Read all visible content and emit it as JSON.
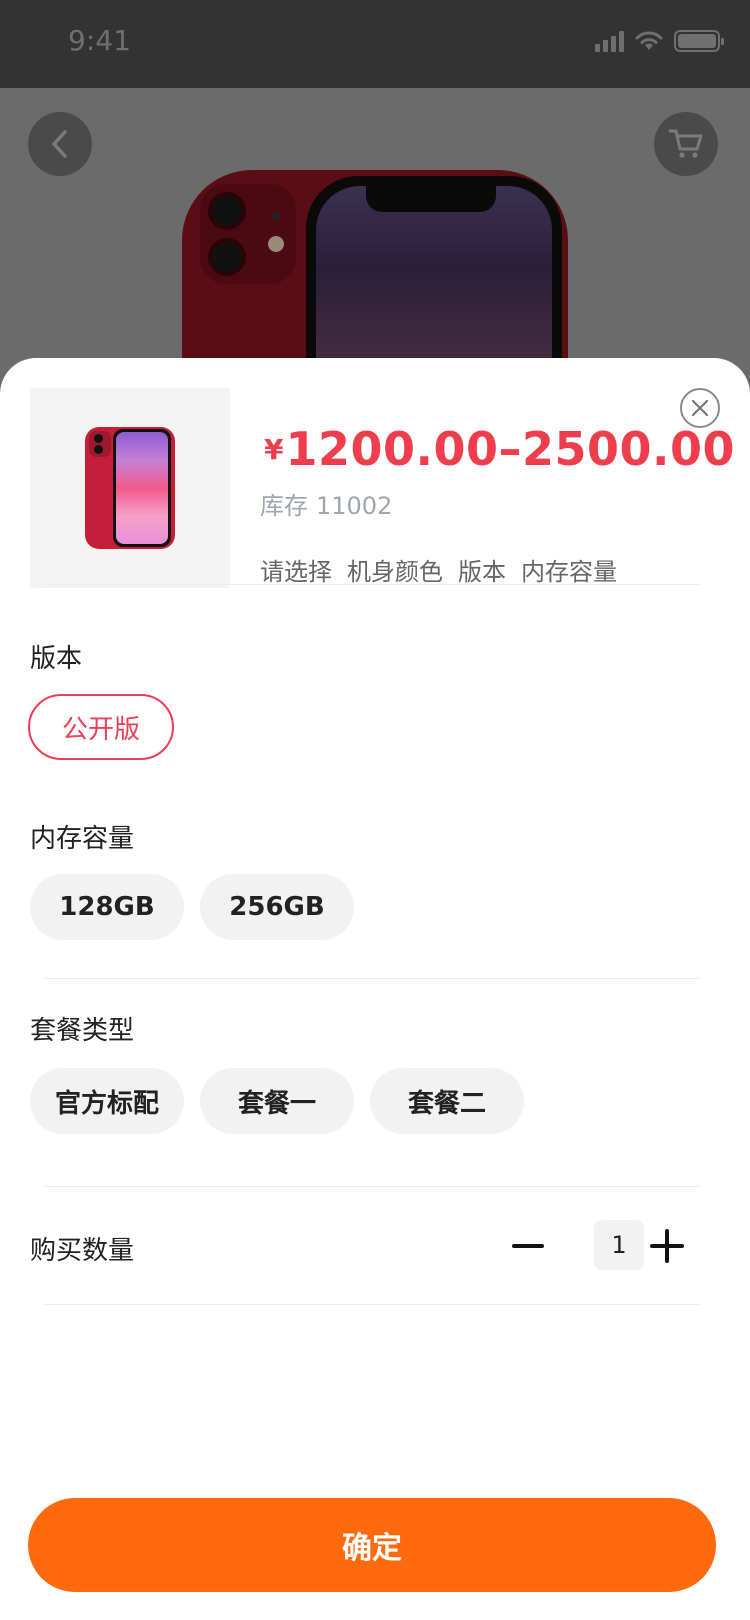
{
  "status_bar": {
    "time": "9:41"
  },
  "product": {
    "currency": "¥",
    "price_range": "1200.00–2500.00",
    "stock_label": "库存",
    "stock_count": "11002",
    "choose_prompt": [
      "请选择",
      "机身颜色",
      "版本",
      "内存容量"
    ]
  },
  "sections": {
    "version": {
      "label": "版本",
      "options": [
        "公开版"
      ],
      "selected": "公开版"
    },
    "storage": {
      "label": "内存容量",
      "options": [
        "128GB",
        "256GB"
      ]
    },
    "package": {
      "label": "套餐类型",
      "options": [
        "官方标配",
        "套餐一",
        "套餐二"
      ]
    },
    "quantity": {
      "label": "购买数量",
      "value": "1"
    }
  },
  "confirm_label": "确定",
  "colors": {
    "accent_red": "#ee3e4e",
    "confirm_orange": "#ff6a0d",
    "chip_bg": "#f2f2f2"
  }
}
